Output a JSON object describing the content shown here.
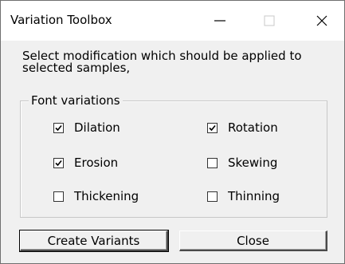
{
  "window": {
    "title": "Variation Toolbox",
    "controls": {
      "minimize": "minimize",
      "maximize": "maximize",
      "close": "close"
    }
  },
  "instructions": "Select modification which should be applied to selected samples,",
  "font_variations": {
    "label": "Font variations",
    "options": [
      {
        "label": "Dilation",
        "checked": true
      },
      {
        "label": "Rotation",
        "checked": true
      },
      {
        "label": "Erosion",
        "checked": true
      },
      {
        "label": "Skewing",
        "checked": false
      },
      {
        "label": "Thickening",
        "checked": false
      },
      {
        "label": "Thinning",
        "checked": false
      }
    ]
  },
  "buttons": {
    "create": "Create Variants",
    "close": "Close"
  }
}
